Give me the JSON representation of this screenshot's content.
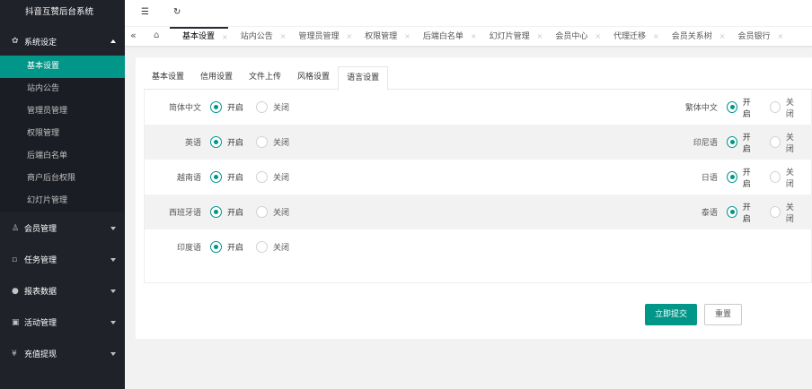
{
  "app": {
    "title": "抖音互赞后台系统"
  },
  "sidebar": {
    "groups": [
      {
        "label": "系统设定",
        "icon": "gear-icon",
        "expanded": true,
        "items": [
          {
            "label": "基本设置",
            "active": true
          },
          {
            "label": "站内公告"
          },
          {
            "label": "管理员管理"
          },
          {
            "label": "权限管理"
          },
          {
            "label": "后端白名单"
          },
          {
            "label": "商户后台权限"
          },
          {
            "label": "幻灯片管理"
          }
        ]
      },
      {
        "label": "会员管理",
        "icon": "user-icon"
      },
      {
        "label": "任务管理",
        "icon": "document-icon"
      },
      {
        "label": "报表数据",
        "icon": "chat-icon"
      },
      {
        "label": "活动管理",
        "icon": "gift-icon"
      },
      {
        "label": "充值提现",
        "icon": "yen-icon"
      }
    ]
  },
  "topbar": {
    "menu_icon": "☰",
    "refresh_icon": "↻"
  },
  "tabbar": {
    "prev_icon": "«",
    "home_icon": "⌂",
    "tabs": [
      {
        "label": "基本设置",
        "active": true
      },
      {
        "label": "站内公告"
      },
      {
        "label": "管理员管理"
      },
      {
        "label": "权限管理"
      },
      {
        "label": "后端白名单"
      },
      {
        "label": "幻灯片管理"
      },
      {
        "label": "会员中心"
      },
      {
        "label": "代理迁移"
      },
      {
        "label": "会员关系树"
      },
      {
        "label": "会员银行"
      }
    ],
    "close_glyph": "×"
  },
  "settings_tabs": [
    {
      "label": "基本设置"
    },
    {
      "label": "信用设置"
    },
    {
      "label": "文件上传"
    },
    {
      "label": "风格设置"
    },
    {
      "label": "语言设置",
      "active": true
    }
  ],
  "languages": [
    {
      "label": "简体中文",
      "enabled": true
    },
    {
      "label": "繁体中文",
      "enabled": true
    },
    {
      "label": "英语",
      "enabled": true
    },
    {
      "label": "印尼语",
      "enabled": true
    },
    {
      "label": "越南语",
      "enabled": true
    },
    {
      "label": "日语",
      "enabled": true
    },
    {
      "label": "西班牙语",
      "enabled": true
    },
    {
      "label": "泰语",
      "enabled": true
    },
    {
      "label": "印度语",
      "enabled": true
    }
  ],
  "radio_labels": {
    "on": "开启",
    "off": "关闭"
  },
  "actions": {
    "submit": "立即提交",
    "reset": "重置"
  },
  "colors": {
    "accent": "#009688",
    "sidebar_bg": "#20222a"
  }
}
